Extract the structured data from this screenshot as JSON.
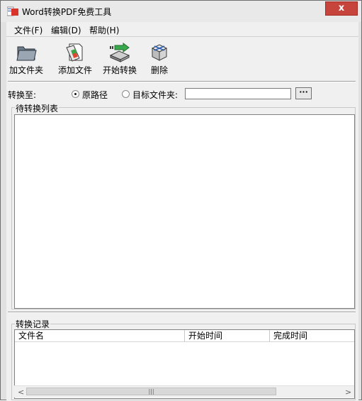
{
  "window": {
    "title": "Word转换PDF免费工具",
    "close_glyph": "x"
  },
  "menu": [
    {
      "label": "文件(F)"
    },
    {
      "label": "编辑(D)"
    },
    {
      "label": "帮助(H)"
    }
  ],
  "toolbar": [
    {
      "label": "加文件夹",
      "icon": "folder-icon"
    },
    {
      "label": "添加文件",
      "icon": "add-file-icon"
    },
    {
      "label": "开始转换",
      "icon": "start-convert-icon"
    },
    {
      "label": "删除",
      "icon": "delete-icon"
    }
  ],
  "convert_to": {
    "label": "转换至:",
    "option_original": "原路径",
    "option_target": "目标文件夹:",
    "selected": "原路径",
    "target_path": "",
    "browse_label": "···"
  },
  "pending_list": {
    "title": "待转换列表"
  },
  "log": {
    "title": "转换记录",
    "columns": [
      "文件名",
      "开始时间",
      "完成时间"
    ],
    "scroll_thumb_glyph": "|||"
  },
  "colors": {
    "close_button": "#c7443c",
    "window_bg": "#f0f0f0"
  }
}
